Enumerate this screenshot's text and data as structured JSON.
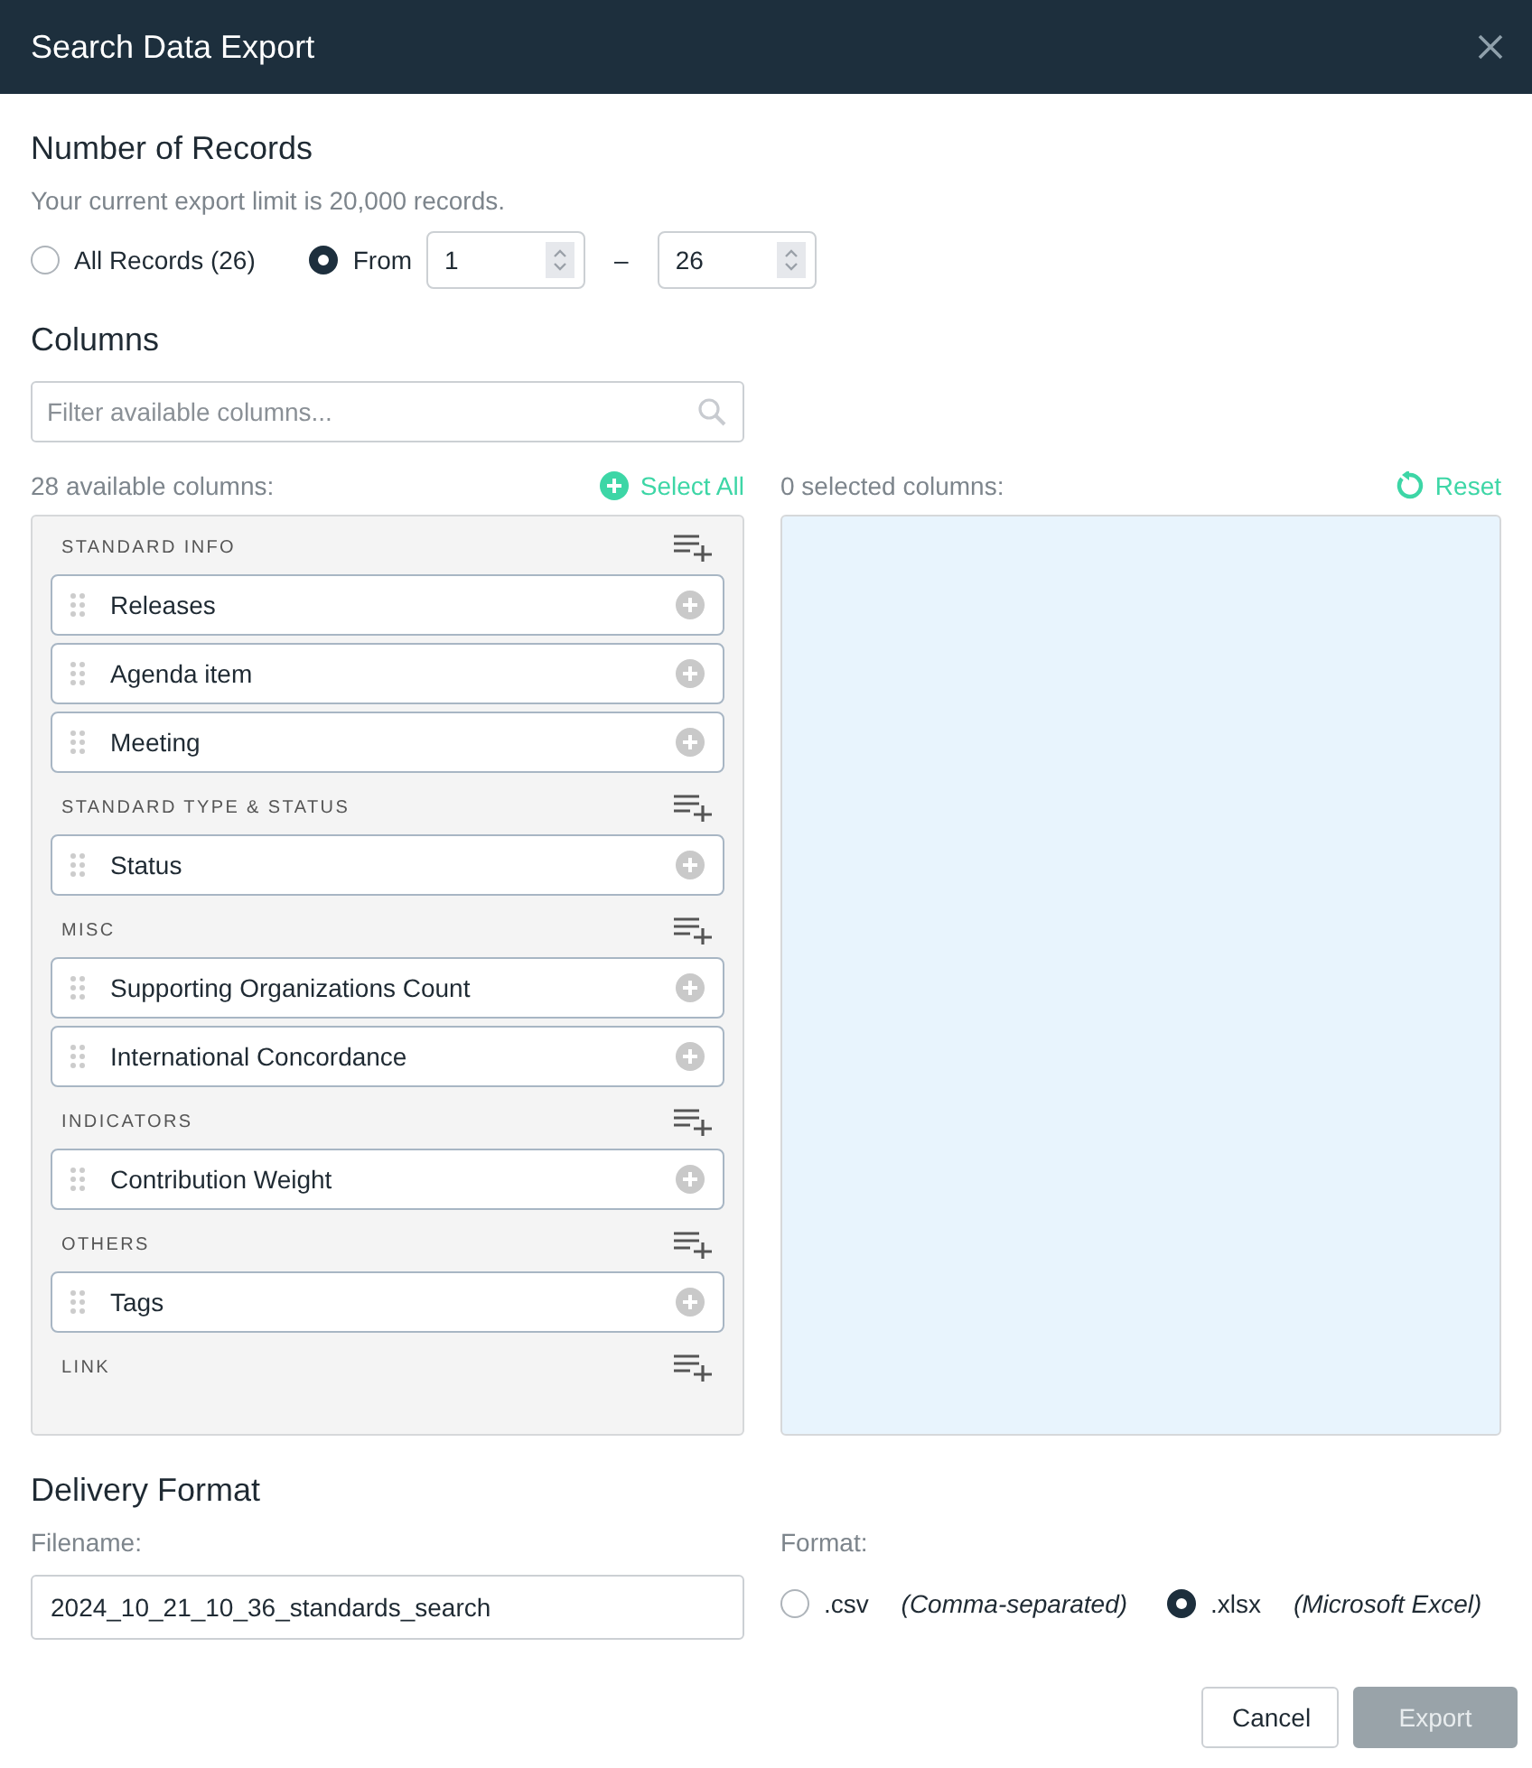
{
  "window": {
    "title": "Search Data Export"
  },
  "records": {
    "heading": "Number of Records",
    "note": "Your current export limit is 20,000 records.",
    "options": [
      {
        "kind": "all",
        "label": "All Records (26)",
        "selected": false
      },
      {
        "kind": "range",
        "label": "From",
        "selected": true,
        "from": "1",
        "separator": "–",
        "to": "26"
      }
    ]
  },
  "columns": {
    "heading": "Columns",
    "filter": {
      "placeholder": "Filter available columns..."
    },
    "available_label": "28 available columns:",
    "select_all": "Select All",
    "selected_label": "0 selected columns:",
    "reset": "Reset",
    "groups": [
      {
        "name": "STANDARD INFO",
        "items": [
          "Releases",
          "Agenda item",
          "Meeting"
        ]
      },
      {
        "name": "STANDARD TYPE & STATUS",
        "items": [
          "Status"
        ]
      },
      {
        "name": "MISC",
        "items": [
          "Supporting Organizations Count",
          "International Concordance"
        ]
      },
      {
        "name": "INDICATORS",
        "items": [
          "Contribution Weight"
        ]
      },
      {
        "name": "OTHERS",
        "items": [
          "Tags"
        ]
      },
      {
        "name": "LINK"
      }
    ]
  },
  "delivery": {
    "heading": "Delivery Format",
    "filename_label": "Filename:",
    "filename": "2024_10_21_10_36_standards_search",
    "format_label": "Format:",
    "formats": [
      {
        "label": ".csv",
        "note": "(Comma-separated)",
        "selected": false
      },
      {
        "label": ".xlsx",
        "note": "(Microsoft Excel)",
        "selected": true
      }
    ]
  },
  "buttons": [
    {
      "label": "Cancel",
      "kind": "secondary",
      "disabled": false
    },
    {
      "label": "Export",
      "kind": "primary",
      "disabled": true
    }
  ]
}
